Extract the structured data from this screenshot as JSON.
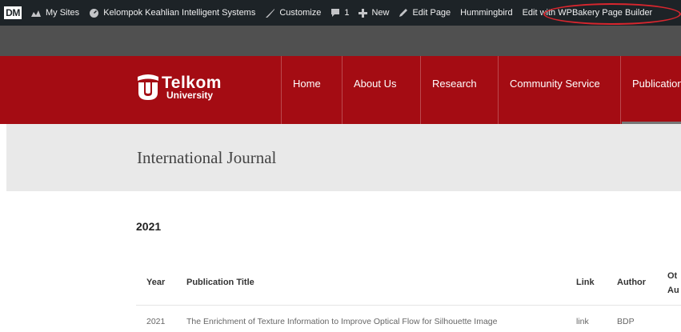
{
  "adminbar": {
    "logo_text": "DM",
    "items": [
      {
        "label": "My Sites",
        "icon": "sites-icon"
      },
      {
        "label": "Kelompok Keahlian Intelligent Systems",
        "icon": "dashboard-icon"
      },
      {
        "label": "Customize",
        "icon": "brush-icon"
      },
      {
        "label": "1",
        "icon": "comment-icon"
      },
      {
        "label": "New",
        "icon": "plus-icon"
      },
      {
        "label": "Edit Page",
        "icon": "pencil-icon"
      },
      {
        "label": "Hummingbird",
        "icon": ""
      },
      {
        "label": "Edit with WPBakery Page Builder",
        "icon": ""
      }
    ],
    "highlight_color": "#d7262e"
  },
  "header": {
    "logo_line1": "Telkom",
    "logo_line2": "University",
    "brand_color": "#a40c13",
    "nav": [
      "Home",
      "About Us",
      "Research",
      "Community Service",
      "Publication"
    ]
  },
  "page": {
    "title": "International Journal"
  },
  "content": {
    "year_heading": "2021",
    "table": {
      "headers": [
        "Year",
        "Publication Title",
        "Link",
        "Author",
        "Ot",
        "Au"
      ],
      "rows": [
        [
          "2021",
          "The Enrichment of Texture Information to Improve Optical Flow for Silhouette Image",
          "link",
          "BDP"
        ]
      ]
    }
  }
}
